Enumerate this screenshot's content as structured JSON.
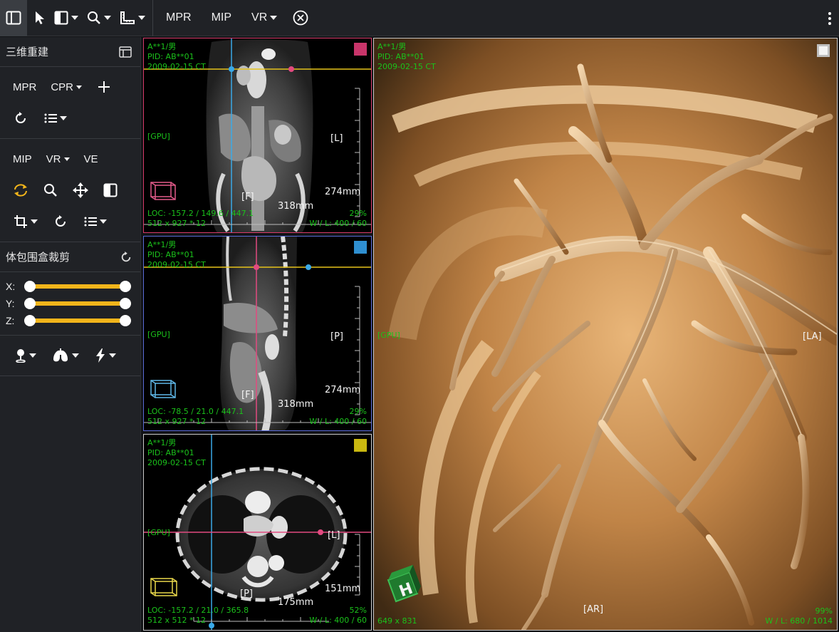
{
  "toolbar": {
    "mpr_label": "MPR",
    "mip_label": "MIP",
    "vr_label": "VR"
  },
  "panel": {
    "title": "三维重建",
    "recon": {
      "mpr_label": "MPR",
      "cpr_label": "CPR"
    },
    "render": {
      "mip_label": "MIP",
      "vr_label": "VR",
      "ve_label": "VE"
    },
    "crop": {
      "title": "体包围盒裁剪",
      "sliders": [
        {
          "label": "X:",
          "min": 0.0,
          "max": 1.0
        },
        {
          "label": "Y:",
          "min": 0.0,
          "max": 1.0
        },
        {
          "label": "Z:",
          "min": 0.0,
          "max": 1.0
        }
      ]
    }
  },
  "colors": {
    "accent": "#f2b51b",
    "overlay_green": "#1bc21b",
    "coronal": "#c8356a",
    "sagittal": "#2f8fd0",
    "axial": "#c9b810",
    "crosshair_yellow": "#e6c21a",
    "crosshair_blue": "#3aa9e8",
    "crosshair_pink": "#e24a80"
  },
  "viewports": {
    "coronal": {
      "patient": "A**1/男",
      "pid": "PID: AB**01",
      "date": "2009-02-15 CT",
      "gpu": "[GPU]",
      "orient_side": "[L]",
      "orient_bottom": "[F]",
      "scale_v": "274mm",
      "scale_h": "318mm",
      "loc": "LOC: -157.2 / 149.6 / 447.1",
      "zoom": "29%",
      "matrix": "512 x 927 * 12",
      "wl": "W / L:  400 / 60"
    },
    "sagittal": {
      "patient": "A**1/男",
      "pid": "PID: AB**01",
      "date": "2009-02-15 CT",
      "gpu": "[GPU]",
      "orient_side": "[P]",
      "orient_bottom": "[F]",
      "scale_v": "274mm",
      "scale_h": "318mm",
      "loc": "LOC: -78.5 / 21.0 / 447.1",
      "zoom": "29%",
      "matrix": "512 x 927 * 12",
      "wl": "W / L:  400 / 60"
    },
    "axial": {
      "patient": "A**1/男",
      "pid": "PID: AB**01",
      "date": "2009-02-15 CT",
      "gpu": "[GPU]",
      "orient_side": "[L]",
      "orient_bottom": "[P]",
      "scale_v": "151mm",
      "scale_h": "175mm",
      "loc": "LOC: -157.2 / 21.0 / 365.8",
      "zoom": "52%",
      "matrix": "512 x 512 * 12",
      "wl": "W / L:  400 / 60"
    },
    "volume": {
      "patient": "A**1/男",
      "pid": "PID: AB**01",
      "date": "2009-02-15 CT",
      "gpu": "[GPU]",
      "orient_side": "[LA]",
      "orient_bottom": "[AR]",
      "orient_cube": "H",
      "zoom": "99%",
      "matrix": "649 x 831",
      "wl": "W / L:  680 / 1014"
    }
  }
}
